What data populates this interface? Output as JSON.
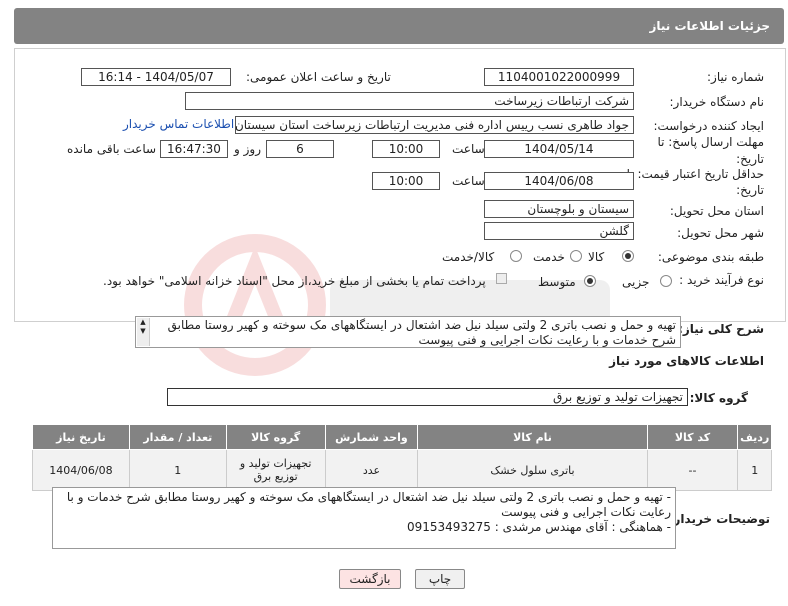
{
  "header": {
    "title": "جزئیات اطلاعات نیاز"
  },
  "form": {
    "need_number_label": "شماره نیاز:",
    "need_number": "1104001022000999",
    "announce_label": "تاریخ و ساعت اعلان عمومی:",
    "announce_value": "1404/05/07 - 16:14",
    "buyer_org_label": "نام دستگاه خریدار:",
    "buyer_org": "شرکت ارتباطات زیرساخت",
    "creator_label": "ایجاد کننده درخواست:",
    "creator": "جواد طاهری نسب رییس اداره فنی مدیریت ارتباطات زیرساخت استان سیستان و",
    "contact_link": "اطلاعات تماس خریدار",
    "reply_deadline_label": "مهلت ارسال پاسخ: تا تاریخ:",
    "reply_date": "1404/05/14",
    "time_label": "ساعت",
    "reply_time": "10:00",
    "days": "6",
    "days_label": "روز و",
    "remaining_time": "16:47:30",
    "remaining_label": "ساعت باقی مانده",
    "price_deadline_label": "حداقل تاریخ اعتبار قیمت: تا تاریخ:",
    "price_date": "1404/06/08",
    "price_time": "10:00",
    "province_label": "استان محل تحویل:",
    "province": "سیستان و بلوچستان",
    "city_label": "شهر محل تحویل:",
    "city": "گلشن",
    "category_label": "طبقه بندی موضوعی:",
    "category_options": [
      "کالا",
      "خدمت",
      "کالا/خدمت"
    ],
    "process_label": "نوع فرآیند خرید :",
    "process_options": [
      "جزیی",
      "متوسط"
    ],
    "payment_note": "پرداخت تمام یا بخشی از مبلغ خرید،از محل \"اسناد خزانه اسلامی\" خواهد بود.",
    "description_label": "شرح کلی نیاز:",
    "description": "تهیه و حمل و نصب باتری 2 ولتی سیلد نیل ضد اشتعال در ایستگاههای مک سوخته و کهیر روستا مطابق شرح خدمات و با رعایت نکات اجرایی و فنی پیوست"
  },
  "goods": {
    "section_title": "اطلاعات کالاهای مورد نیاز",
    "group_label": "گروه کالا:",
    "group_value": "تجهیزات تولید و توزیع برق",
    "columns": [
      "ردیف",
      "کد کالا",
      "نام کالا",
      "واحد شمارش",
      "گروه کالا",
      "تعداد / مقدار",
      "تاریخ نیاز"
    ],
    "rows": [
      [
        "1",
        "--",
        "باتری سلول خشک",
        "عدد",
        "تجهیزات تولید و توزیع برق",
        "1",
        "1404/06/08"
      ]
    ]
  },
  "buyer_notes": {
    "label": "توضیحات خریدار:",
    "line1": "- تهیه و حمل و نصب باتری 2 ولتی سیلد نیل ضد اشتعال در ایستگاههای مک سوخته و کهیر روستا مطابق شرح خدمات و با",
    "line2": "رعایت نکات اجرایی و فنی پیوست",
    "line3": "- هماهنگی : آقای مهندس مرشدی : 09153493275"
  },
  "buttons": {
    "print": "چاپ",
    "back": "بازگشت"
  },
  "colors": {
    "header_bg": "#838383",
    "link": "#1b4fb0",
    "back_button_bg": "#fde3e3"
  }
}
